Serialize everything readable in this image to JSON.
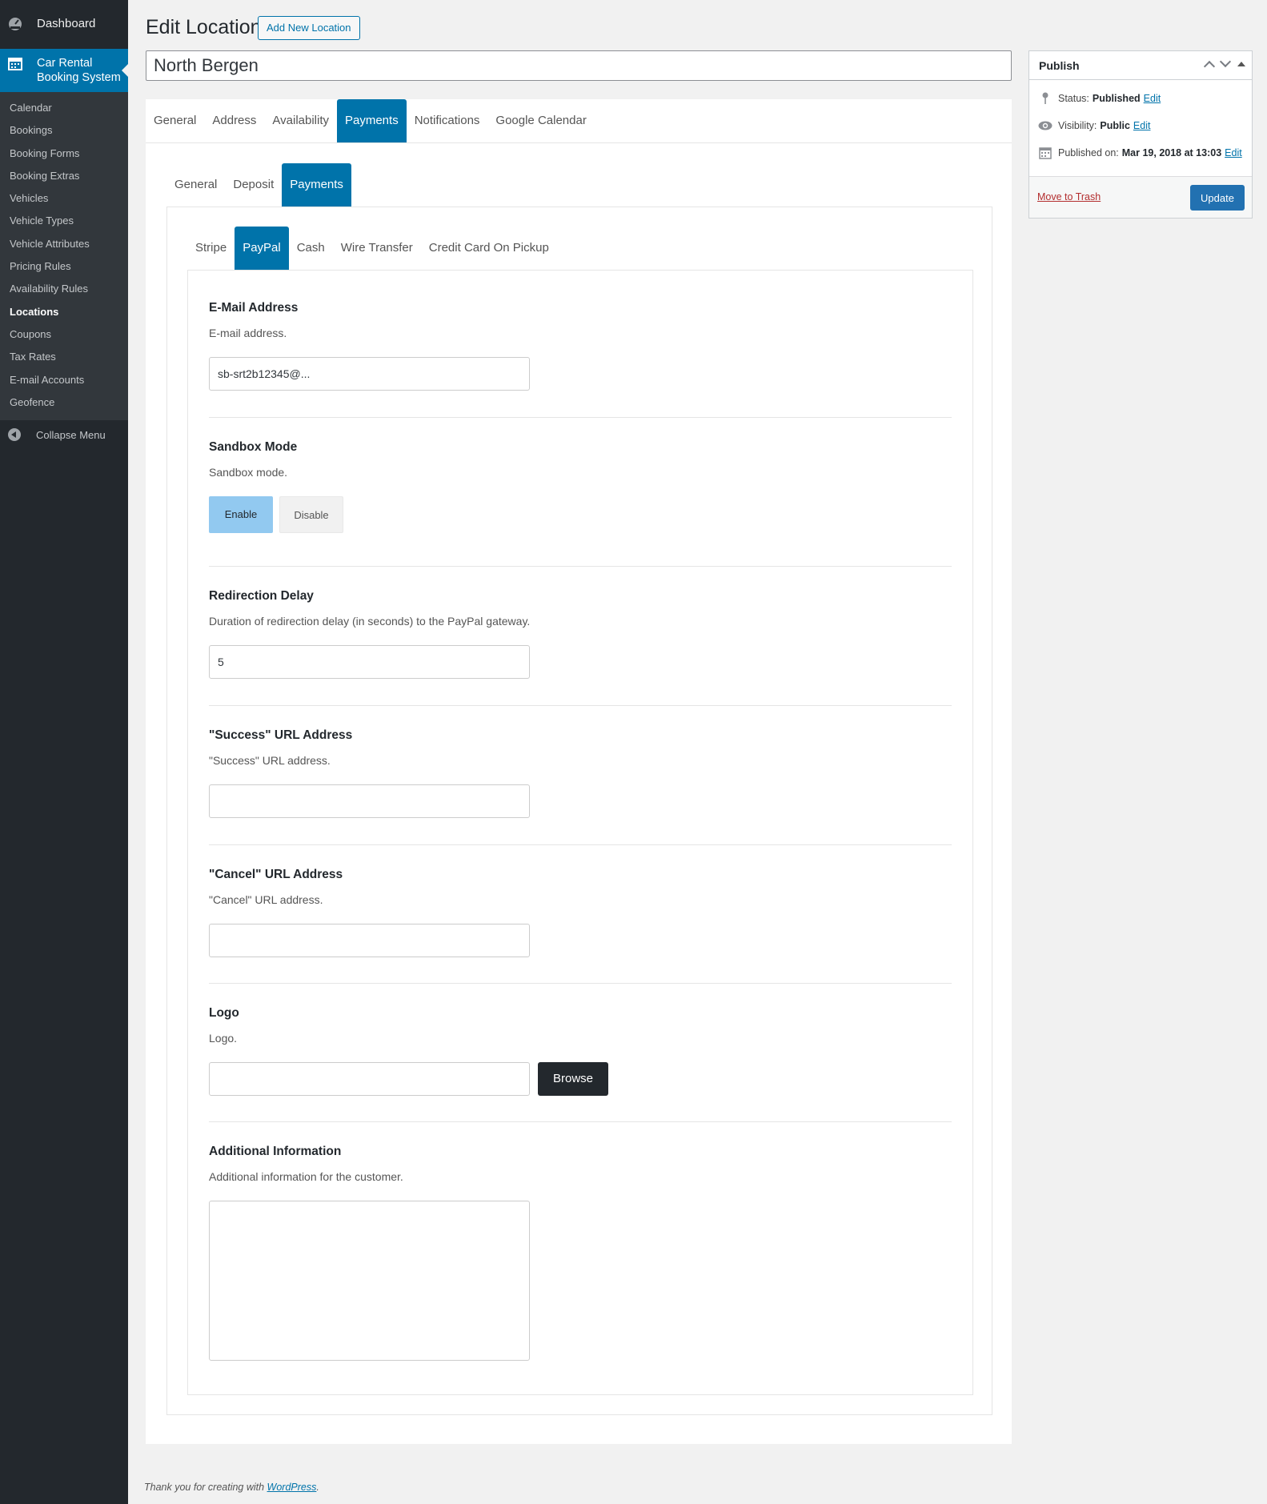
{
  "sidebar": {
    "dashboard": "Dashboard",
    "current_plugin": "Car Rental Booking System",
    "items": [
      {
        "label": "Calendar",
        "active": false
      },
      {
        "label": "Bookings",
        "active": false
      },
      {
        "label": "Booking Forms",
        "active": false
      },
      {
        "label": "Booking Extras",
        "active": false
      },
      {
        "label": "Vehicles",
        "active": false
      },
      {
        "label": "Vehicle Types",
        "active": false
      },
      {
        "label": "Vehicle Attributes",
        "active": false
      },
      {
        "label": "Pricing Rules",
        "active": false
      },
      {
        "label": "Availability Rules",
        "active": false
      },
      {
        "label": "Locations",
        "active": true
      },
      {
        "label": "Coupons",
        "active": false
      },
      {
        "label": "Tax Rates",
        "active": false
      },
      {
        "label": "E-mail Accounts",
        "active": false
      },
      {
        "label": "Geofence",
        "active": false
      }
    ],
    "collapse": "Collapse Menu"
  },
  "header": {
    "title": "Edit Location",
    "add_new": "Add New Location",
    "post_title": "North Bergen"
  },
  "tabs_level1": [
    {
      "label": "General",
      "active": false
    },
    {
      "label": "Address",
      "active": false
    },
    {
      "label": "Availability",
      "active": false
    },
    {
      "label": "Payments",
      "active": true
    },
    {
      "label": "Notifications",
      "active": false
    },
    {
      "label": "Google Calendar",
      "active": false
    }
  ],
  "tabs_level2": [
    {
      "label": "General",
      "active": false
    },
    {
      "label": "Deposit",
      "active": false
    },
    {
      "label": "Payments",
      "active": true
    }
  ],
  "tabs_level3": [
    {
      "label": "Stripe",
      "active": false
    },
    {
      "label": "PayPal",
      "active": true
    },
    {
      "label": "Cash",
      "active": false
    },
    {
      "label": "Wire Transfer",
      "active": false
    },
    {
      "label": "Credit Card On Pickup",
      "active": false
    }
  ],
  "form": {
    "email": {
      "label": "E-Mail Address",
      "desc": "E-mail address.",
      "value": "sb-srt2b12345@..."
    },
    "sandbox": {
      "label": "Sandbox Mode",
      "desc": "Sandbox mode.",
      "enable": "Enable",
      "disable": "Disable",
      "selected": "Enable"
    },
    "delay": {
      "label": "Redirection Delay",
      "desc": "Duration of redirection delay (in seconds) to the PayPal gateway.",
      "value": "5"
    },
    "success_url": {
      "label": "\"Success\" URL Address",
      "desc": "\"Success\" URL address.",
      "value": ""
    },
    "cancel_url": {
      "label": "\"Cancel\" URL Address",
      "desc": "\"Cancel\" URL address.",
      "value": ""
    },
    "logo": {
      "label": "Logo",
      "desc": "Logo.",
      "value": "",
      "browse": "Browse"
    },
    "additional": {
      "label": "Additional Information",
      "desc": "Additional information for the customer.",
      "value": ""
    }
  },
  "publish": {
    "title": "Publish",
    "status_label": "Status:",
    "status_value": "Published",
    "visibility_label": "Visibility:",
    "visibility_value": "Public",
    "published_label": "Published on:",
    "published_value": "Mar 19, 2018 at 13:03",
    "edit": "Edit",
    "trash": "Move to Trash",
    "update": "Update"
  },
  "footer": {
    "text": "Thank you for creating with ",
    "link": "WordPress",
    "end": "."
  },
  "colors": {
    "sidebar_bg": "#23282d",
    "accent": "#0073aa",
    "enable_btn": "#92c9f0",
    "browse_btn": "#23282d",
    "trash_link": "#b32d2e"
  }
}
